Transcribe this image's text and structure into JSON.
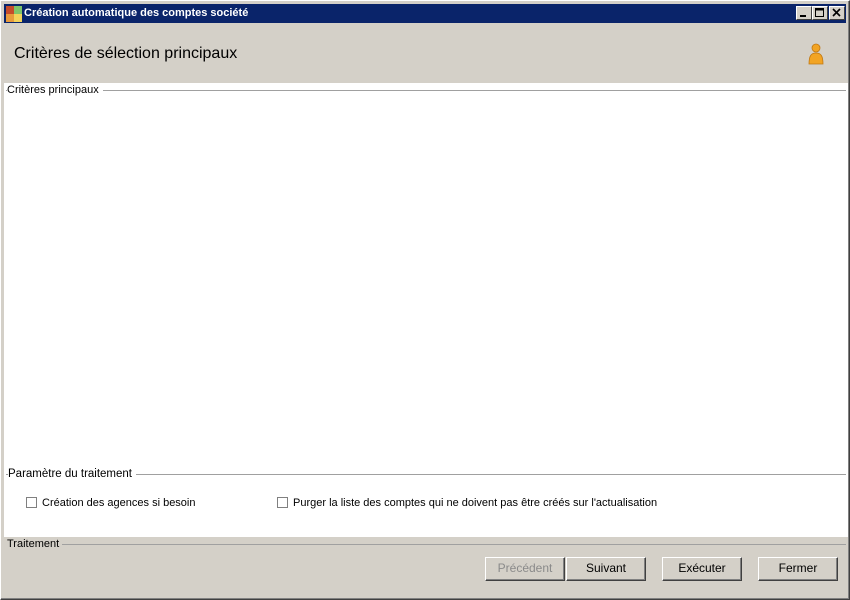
{
  "window": {
    "title": "Création automatique des comptes société",
    "icons": [
      "app-icon",
      "minimize-icon",
      "maximize-icon",
      "close-icon"
    ]
  },
  "header": {
    "title": "Critères de sélection principaux",
    "icon": "user-icon"
  },
  "groups": {
    "main_criteria": "Critères principaux",
    "processing_params": "Paramètre du traitement",
    "processing": "Traitement"
  },
  "options": {
    "create_agencies": {
      "label": "Création des agences si besoin",
      "checked": false
    },
    "purge_accounts": {
      "label": "Purger la liste des comptes qui ne doivent pas être créés sur l'actualisation",
      "checked": false
    }
  },
  "buttons": {
    "previous": {
      "label": "Précédent",
      "enabled": false
    },
    "next": {
      "label": "Suivant",
      "enabled": true
    },
    "execute": {
      "label": "Exécuter",
      "enabled": true
    },
    "close": {
      "label": "Fermer",
      "enabled": true
    }
  },
  "colors": {
    "titlebar": "#0a246a",
    "chrome": "#d4d0c8",
    "content": "#ffffff",
    "user_icon": "#f2a424"
  }
}
